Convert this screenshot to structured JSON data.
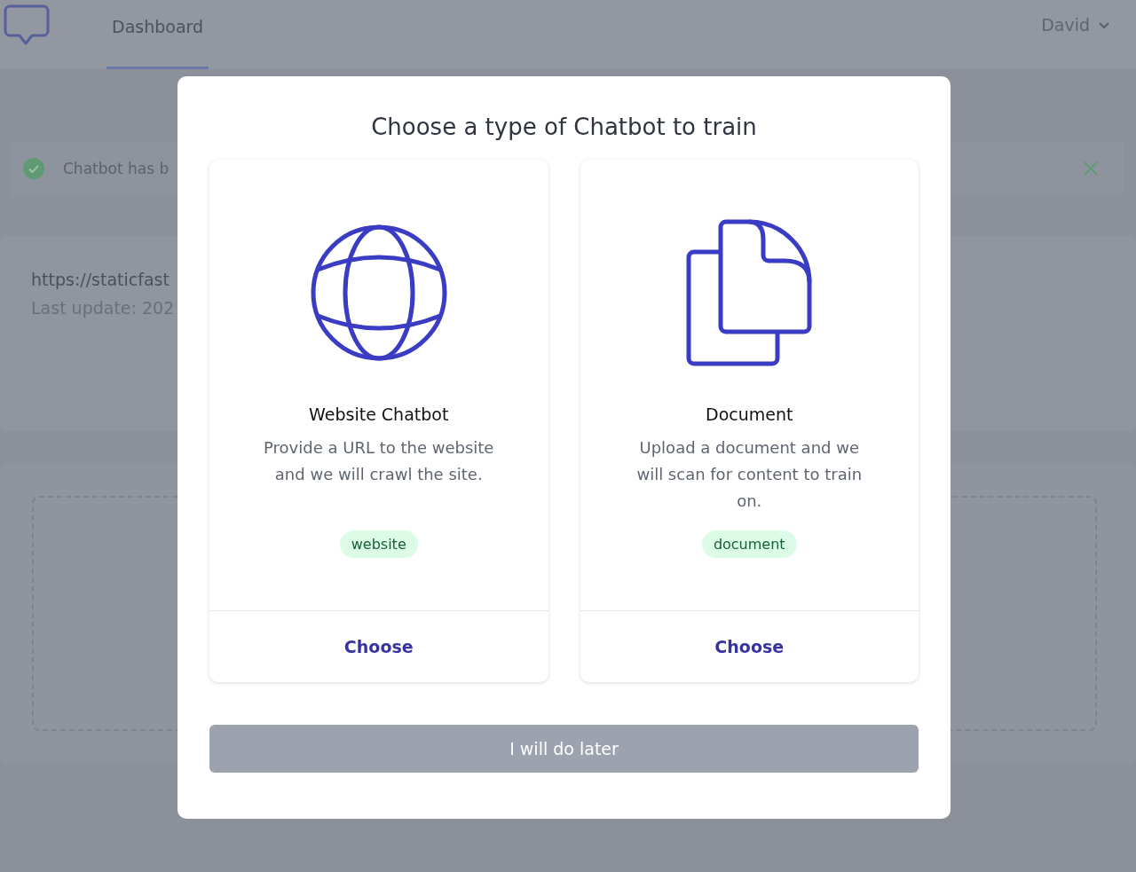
{
  "nav": {
    "tabs": [
      {
        "label": "Dashboard",
        "selected": true
      }
    ],
    "user": "David"
  },
  "alert": {
    "message": "Chatbot has b"
  },
  "source": {
    "url": "https://staticfast",
    "updated": "Last update: 202"
  },
  "modal": {
    "title": "Choose a type of Chatbot to train",
    "options": [
      {
        "kind": "website",
        "title": "Website Chatbot",
        "description": "Provide a URL to the website and we will crawl the site.",
        "tag": "website",
        "action": "Choose"
      },
      {
        "kind": "document",
        "title": "Document",
        "description": "Upload a document and we will scan for content to train on.",
        "tag": "document",
        "action": "Choose"
      }
    ],
    "later_button": "I will do later"
  }
}
